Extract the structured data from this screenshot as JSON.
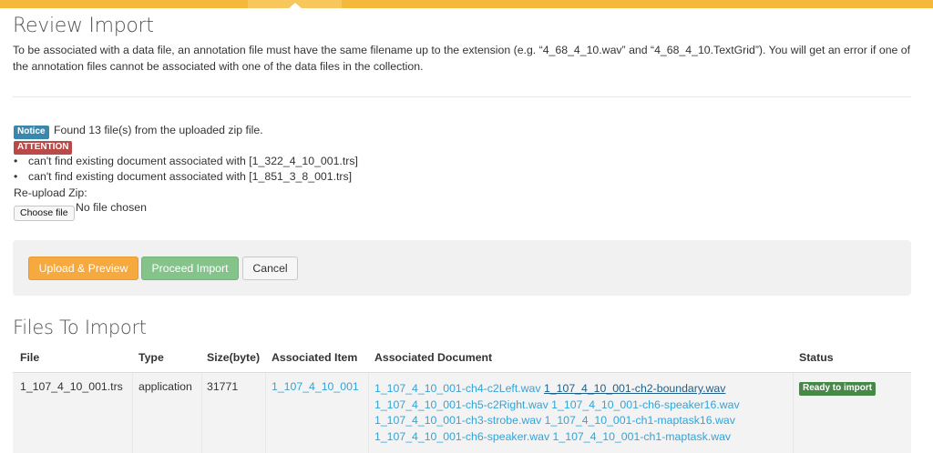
{
  "page": {
    "title": "Review Import",
    "intro": "To be associated with a data file, an annotation file must have the same filename up to the extension (e.g. “4_68_4_10.wav” and “4_68_4_10.TextGrid”). You will get an error if one of the annotation files cannot be associated with one of the data files in the collection."
  },
  "notice": {
    "badge": "Notice",
    "message": "Found 13 file(s) from the uploaded zip file."
  },
  "attention": {
    "badge": "ATTENTION",
    "errors": [
      "can't find existing document associated with [1_322_4_10_001.trs]",
      "can't find existing document associated with [1_851_3_8_001.trs]"
    ]
  },
  "reupload": {
    "label": "Re-upload Zip:",
    "choose_button": "Choose file",
    "file_status": "No file chosen"
  },
  "actions": {
    "upload_preview": "Upload & Preview",
    "proceed_import": "Proceed Import",
    "cancel": "Cancel"
  },
  "files_table": {
    "title": "Files To Import",
    "headers": [
      "File",
      "Type",
      "Size(byte)",
      "Associated Item",
      "Associated Document",
      "Status"
    ],
    "rows": [
      {
        "file": "1_107_4_10_001.trs",
        "type": "application",
        "size": "31771",
        "item": "1_107_4_10_001",
        "documents": [
          "1_107_4_10_001-ch4-c2Left.wav",
          "1_107_4_10_001-ch2-boundary.wav",
          "1_107_4_10_001-ch5-c2Right.wav",
          "1_107_4_10_001-ch6-speaker16.wav",
          "1_107_4_10_001-ch3-strobe.wav",
          "1_107_4_10_001-ch1-maptask16.wav",
          "1_107_4_10_001-ch6-speaker.wav",
          "1_107_4_10_001-ch1-maptask.wav"
        ],
        "status": "Ready to import"
      }
    ]
  },
  "colors": {
    "top_bar": "#f4b93a",
    "notice_badge": "#3a87ad",
    "attention_badge": "#b94a48",
    "upload_button": "#f5a93e",
    "proceed_button": "#84c38a",
    "link": "#35a3d6",
    "status_badge": "#468847"
  }
}
